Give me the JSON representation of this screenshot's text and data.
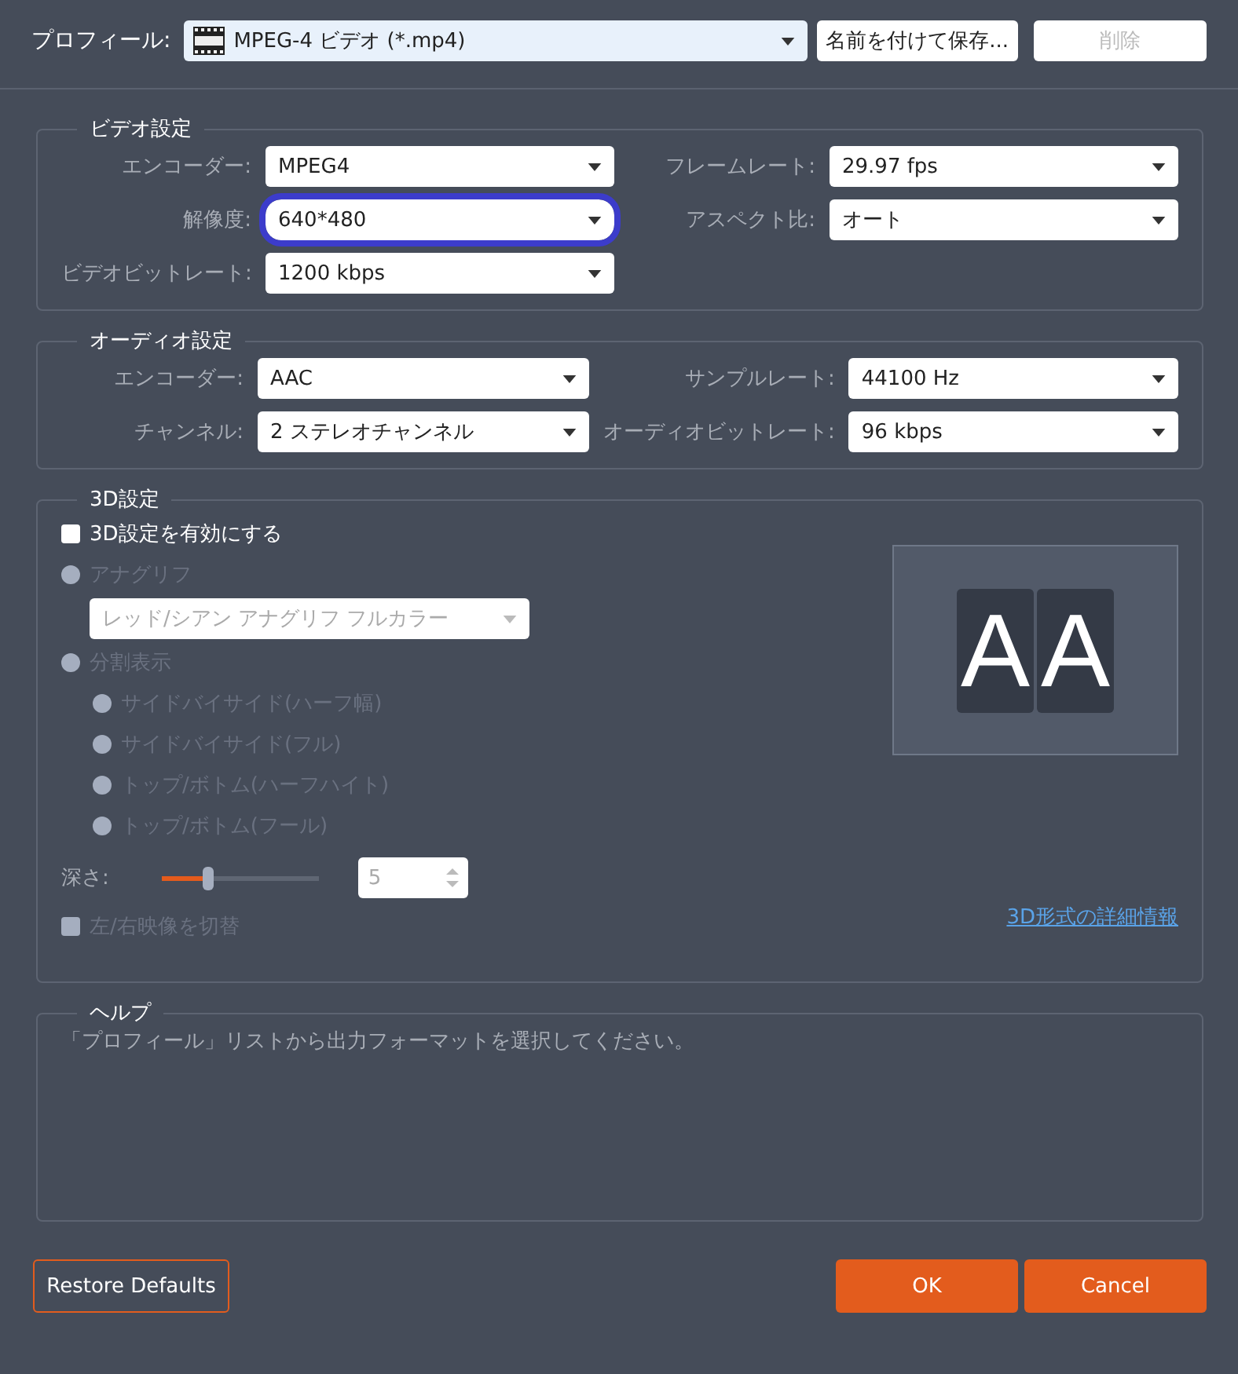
{
  "profile": {
    "label": "プロフィール:",
    "value": "MPEG-4 ビデオ (*.mp4)",
    "buttons": [
      {
        "label": "名前を付けて保存...",
        "disabled": false
      },
      {
        "label": "削除",
        "disabled": true
      }
    ]
  },
  "video": {
    "title": "ビデオ設定",
    "rows": [
      [
        {
          "label": "エンコーダー:",
          "value": "MPEG4",
          "highlighted": false
        },
        {
          "label": "フレームレート:",
          "value": "29.97 fps",
          "highlighted": false
        }
      ],
      [
        {
          "label": "解像度:",
          "value": "640*480",
          "highlighted": true
        },
        {
          "label": "アスペクト比:",
          "value": "オート",
          "highlighted": false
        }
      ],
      [
        {
          "label": "ビデオビットレート:",
          "value": "1200 kbps",
          "highlighted": false
        }
      ]
    ]
  },
  "audio": {
    "title": "オーディオ設定",
    "rows": [
      [
        {
          "label": "エンコーダー:",
          "value": "AAC",
          "highlighted": false
        },
        {
          "label": "サンプルレート:",
          "value": "44100 Hz",
          "highlighted": false
        }
      ],
      [
        {
          "label": "チャンネル:",
          "value": "2 ステレオチャンネル",
          "highlighted": false
        },
        {
          "label": "オーディオビットレート:",
          "value": "96 kbps",
          "highlighted": false
        }
      ]
    ]
  },
  "three_d": {
    "title": "3D設定",
    "enable": {
      "label": "3D設定を有効にする",
      "checked": false,
      "disabled": false
    },
    "options": [
      {
        "kind": "radio",
        "label": "アナグリフ",
        "selected": false,
        "disabled": true
      },
      {
        "kind": "dropdown",
        "value": "レッド/シアン アナグリフ フルカラー",
        "disabled": true
      },
      {
        "kind": "radio",
        "label": "分割表示",
        "selected": false,
        "disabled": true,
        "children": [
          {
            "label": "サイドバイサイド(ハーフ幅)",
            "selected": false,
            "disabled": true
          },
          {
            "label": "サイドバイサイド(フル)",
            "selected": false,
            "disabled": true
          },
          {
            "label": "トップ/ボトム(ハーフハイト)",
            "selected": false,
            "disabled": true
          },
          {
            "label": "トップ/ボトム(フール)",
            "selected": false,
            "disabled": true
          }
        ]
      }
    ],
    "depth": {
      "label": "深さ:",
      "level": 0.3,
      "value": "5",
      "disabled": true
    },
    "swap": {
      "label": "左/右映像を切替",
      "checked": false,
      "disabled": true
    },
    "preview": {
      "letters": [
        "A",
        "A"
      ]
    },
    "link": "3D形式の詳細情報"
  },
  "help": {
    "title": "ヘルプ",
    "text": "「プロフィール」リストから出力フォーマットを選択してください。"
  },
  "footer": [
    {
      "kind": "outline",
      "label": "Restore Defaults"
    },
    {
      "kind": "primary",
      "label": "OK"
    },
    {
      "kind": "primary",
      "label": "Cancel"
    }
  ]
}
